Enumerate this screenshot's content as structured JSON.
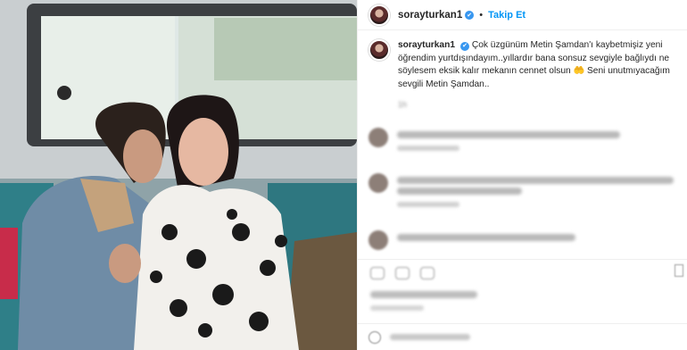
{
  "post": {
    "username": "sorayturkan1",
    "verified_glyph": "✔",
    "separator": "•",
    "follow_label": "Takip Et",
    "caption_username": "sorayturkan1",
    "caption_text": "Çok üzgünüm Metin Şamdan'ı kaybetmişiz yeni öğrendim yurtdışındayım..yıllardır bana sonsuz sevgiyle bağlıydı ne söylesem eksik kalır mekanın cennet olsun 🤲 Seni unutmıyacağım sevgili Metin Şamdan..",
    "caption_time": "1h"
  },
  "icons": {
    "avatar": "profile-avatar",
    "like": "heart-icon",
    "comment": "comment-icon",
    "share": "share-icon",
    "save": "bookmark-icon",
    "emoji": "smile-icon"
  },
  "colors": {
    "accent": "#0095f6",
    "verified": "#3897f0",
    "text": "#262626",
    "muted": "#8e8e8e"
  }
}
